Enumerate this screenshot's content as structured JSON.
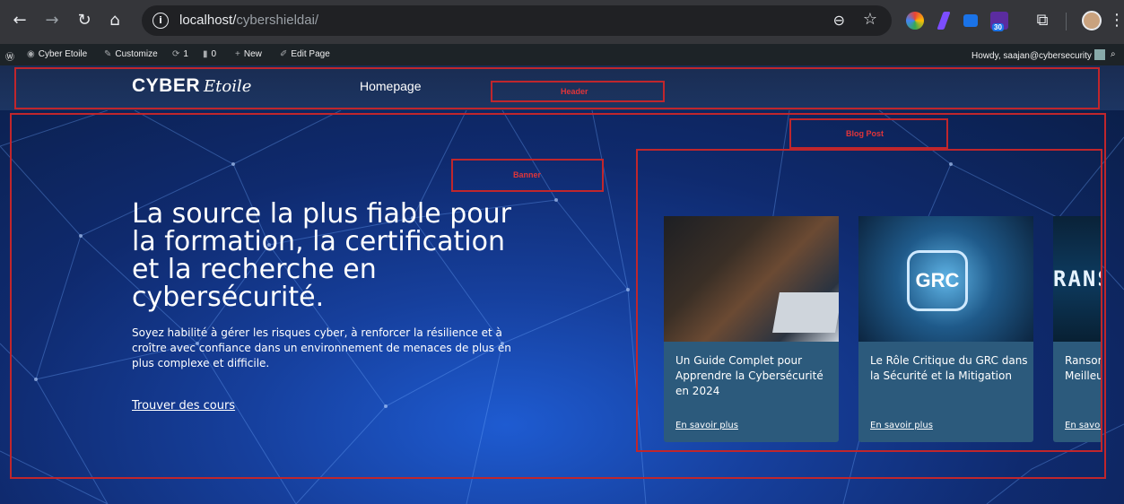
{
  "browser": {
    "url_host": "localhost/",
    "url_path": "cybershieldai/",
    "ext_badge": "30",
    "icons": [
      "back-icon",
      "forward-icon",
      "reload-icon",
      "home-icon",
      "site-info-icon",
      "zoom-icon",
      "bookmark-star-icon",
      "extensions-icon",
      "profile-avatar",
      "menu-icon"
    ]
  },
  "adminbar": {
    "site_name": "Cyber Etoile",
    "customize": "Customize",
    "updates_count": "1",
    "comments_count": "0",
    "new_label": "New",
    "edit_label": "Edit Page",
    "howdy": "Howdy, saajan@cybersecurity"
  },
  "header": {
    "logo_main": "CYBER",
    "logo_script": "Etoile",
    "nav_home": "Homepage"
  },
  "annotations": {
    "header": "Header",
    "banner": "Banner",
    "blog": "Blog Post"
  },
  "hero": {
    "title": "La source la plus fiable pour la formation, la certification et la recherche en cybersécurité.",
    "lead": "Soyez habilité à gérer les risques cyber, à renforcer la résilience et à croître avec confiance dans un environnement de menaces de plus en plus complexe et difficile.",
    "cta": "Trouver des cours"
  },
  "posts": [
    {
      "title": "Un Guide Complet pour Apprendre la Cybersécurité en 2024",
      "more": "En savoir plus"
    },
    {
      "title": "Le Rôle Critique du GRC dans la Sécurité et la Mitigation",
      "more": "En savoir plus",
      "img_text": "GRC"
    },
    {
      "title": "Ransomware Extorsion : Meilleures",
      "more": "En savoir plus",
      "img_text": "RANS"
    }
  ],
  "carousel": {
    "prev": "‹",
    "next": "›"
  },
  "colors": {
    "accent_annotation": "#c0262c",
    "card_bg": "#2c5a7c",
    "header_bg": "#1c3562"
  }
}
